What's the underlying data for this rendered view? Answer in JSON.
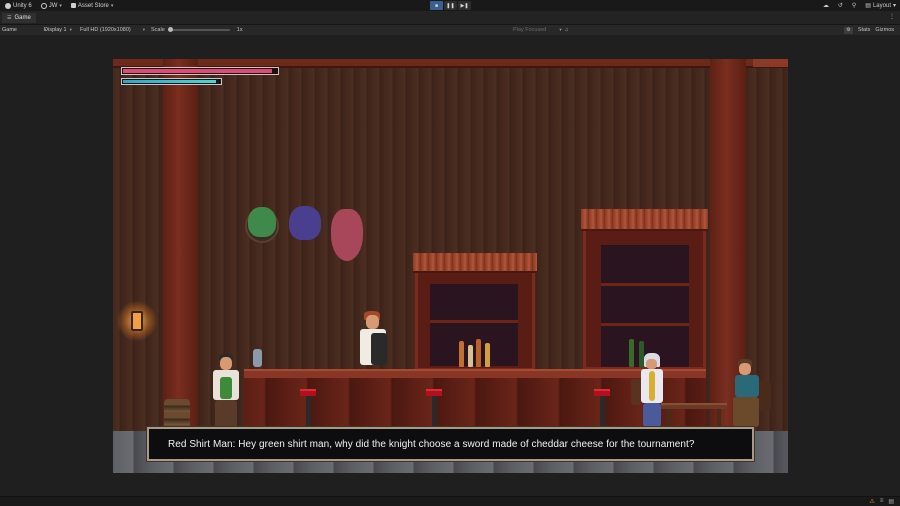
{
  "topbar": {
    "app_label": "Unity 6",
    "account_label": "JW",
    "asset_store_label": "Asset Store",
    "layout_label": "Layout",
    "play_icons": [
      "play-icon",
      "pause-icon",
      "step-icon"
    ],
    "play_glyphs": [
      "■",
      "❚❚",
      "▶❚"
    ]
  },
  "tabbar": {
    "tab_label": "Game",
    "tab_icon_glyph": "☰",
    "menu_glyph": "⋮"
  },
  "gametoolbar": {
    "mode_label": "Game",
    "display_label": "Display 1",
    "resolution_label": "Full HD (1920x1080)",
    "scale_label": "Scale",
    "scale_value": "1x",
    "play_mode_label": "Play Focused",
    "stats_label": "Stats",
    "gizmos_label": "Gizmos"
  },
  "game": {
    "hp_fraction": 0.97,
    "mp_fraction": 0.96,
    "dialog_text": "Red Shirt Man: Hey green shirt man, why did the knight choose a sword made of cheddar cheese for the tournament?",
    "colors": {
      "hp": "#e04a78",
      "mp": "#3fc0cc",
      "wall": "#45291e",
      "stool_seat": "#b01020"
    }
  },
  "statusbar": {
    "icons": [
      "warning-icon",
      "trash-icon",
      "notification-icon"
    ],
    "glyphs": [
      "⚠",
      "≡",
      "▤"
    ]
  }
}
